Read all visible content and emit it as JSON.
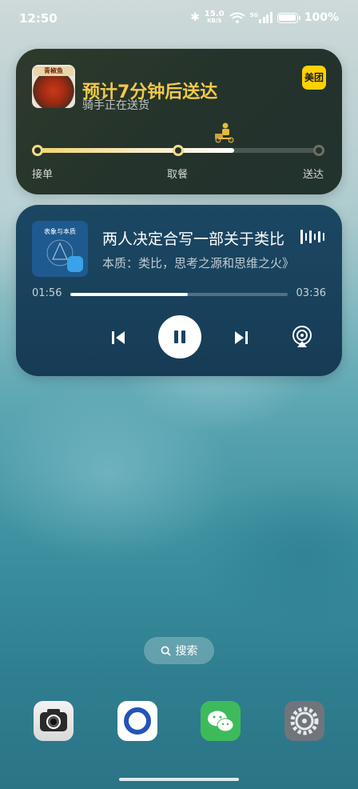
{
  "status_bar": {
    "time": "12:50",
    "net_speed_value": "15.0",
    "net_speed_unit": "KB/S",
    "network_type": "5G",
    "battery": "100%"
  },
  "delivery": {
    "title": "预计7分钟后送达",
    "subtitle": "骑手正在送货",
    "food_label": "青椒鱼",
    "brand_logo": "美团",
    "progress_percent": 70,
    "steps": [
      "接单",
      "取餐",
      "送达"
    ],
    "accent_color": "#f2c94a"
  },
  "music": {
    "cover_title": "表象与本质",
    "line1": "两人决定合写一部关于类比",
    "line2": "本质：类比，思考之源和思维之火》",
    "current_time": "01:56",
    "total_time": "03:36",
    "progress_percent": 54
  },
  "search": {
    "label": "搜索"
  },
  "dock": {
    "apps": [
      "camera-app",
      "browser-app",
      "wechat-app",
      "settings-app"
    ]
  }
}
